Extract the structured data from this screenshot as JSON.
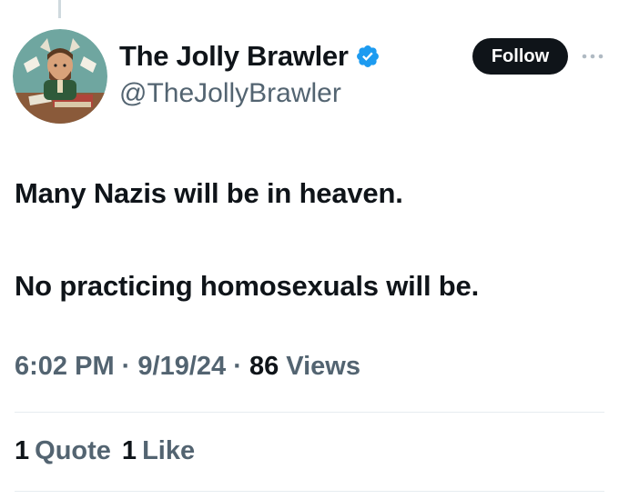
{
  "user": {
    "display_name": "The Jolly Brawler",
    "handle": "@TheJollyBrawler",
    "verified": true,
    "avatar_icon": "avatar-illustration"
  },
  "actions": {
    "follow_label": "Follow",
    "more_icon": "more-horizontal-icon"
  },
  "tweet": {
    "line1": "Many Nazis will be in heaven.",
    "line2": "No practicing homosexuals will be."
  },
  "meta": {
    "time": "6:02 PM",
    "separator": "·",
    "date": "9/19/24",
    "views_count": "86",
    "views_label": "Views"
  },
  "stats": {
    "quotes_count": "1",
    "quotes_label": "Quote",
    "likes_count": "1",
    "likes_label": "Like"
  },
  "colors": {
    "text": "#0f1419",
    "secondary": "#536471",
    "verified": "#1d9bf0",
    "follow_bg": "#0f1419"
  }
}
